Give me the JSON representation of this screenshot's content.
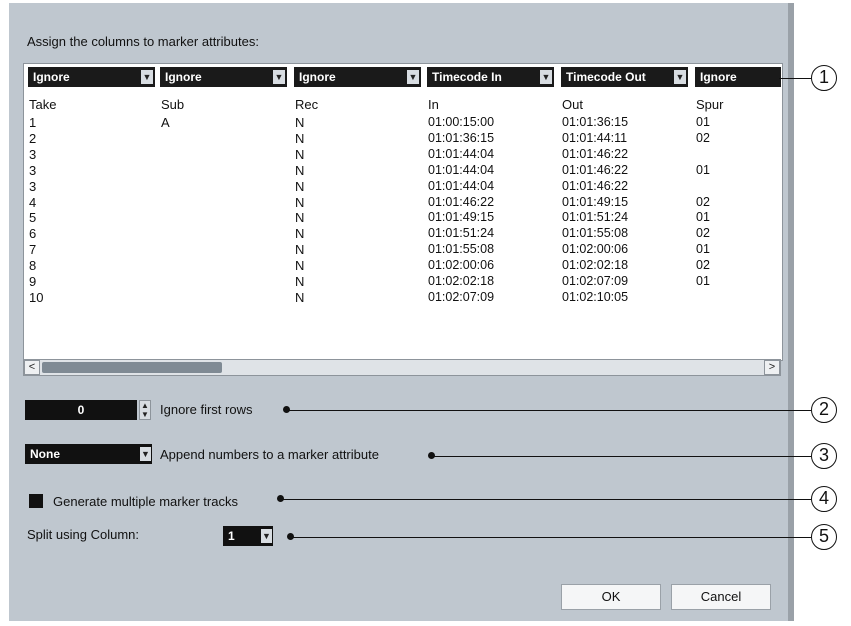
{
  "dialog": {
    "title": "Assign the columns to marker attributes:"
  },
  "columns": [
    {
      "header": "Ignore",
      "label": "Take"
    },
    {
      "header": "Ignore",
      "label": "Sub"
    },
    {
      "header": "Ignore",
      "label": "Rec"
    },
    {
      "header": "Timecode In",
      "label": "In"
    },
    {
      "header": "Timecode Out",
      "label": "Out"
    },
    {
      "header": "Ignore",
      "label": "Spur"
    }
  ],
  "rows": [
    [
      "1",
      "A",
      "N",
      "01:00:15:00",
      "01:01:36:15",
      "01"
    ],
    [
      "2",
      "",
      "N",
      "01:01:36:15",
      "01:01:44:11",
      "02"
    ],
    [
      "3",
      "",
      "N",
      "01:01:44:04",
      "01:01:46:22",
      ""
    ],
    [
      "3",
      "",
      "N",
      "01:01:44:04",
      "01:01:46:22",
      "01"
    ],
    [
      "3",
      "",
      "N",
      "01:01:44:04",
      "01:01:46:22",
      ""
    ],
    [
      "4",
      "",
      "N",
      "01:01:46:22",
      "01:01:49:15",
      "02"
    ],
    [
      "5",
      "",
      "N",
      "01:01:49:15",
      "01:01:51:24",
      "01"
    ],
    [
      "6",
      "",
      "N",
      "01:01:51:24",
      "01:01:55:08",
      "02"
    ],
    [
      "7",
      "",
      "N",
      "01:01:55:08",
      "01:02:00:06",
      "01"
    ],
    [
      "8",
      "",
      "N",
      "01:02:00:06",
      "01:02:02:18",
      "02"
    ],
    [
      "9",
      "",
      "N",
      "01:02:02:18",
      "01:02:07:09",
      "01"
    ],
    [
      "10",
      "",
      "N",
      "01:02:07:09",
      "01:02:10:05",
      ""
    ]
  ],
  "scrollbar": {
    "left": "<",
    "right": ">"
  },
  "ignore_rows": {
    "value": "0",
    "label": "Ignore first rows"
  },
  "append": {
    "value": "None",
    "label": "Append numbers to a marker attribute"
  },
  "generate": {
    "label": "Generate multiple marker tracks",
    "checked": true
  },
  "split": {
    "label": "Split using Column:",
    "value": "1"
  },
  "callouts": [
    "1",
    "2",
    "3",
    "4",
    "5"
  ],
  "buttons": {
    "ok": "OK",
    "cancel": "Cancel"
  },
  "icons": {
    "dropdown": "chevron-down-icon",
    "spinner": "spinner-arrows-icon"
  }
}
